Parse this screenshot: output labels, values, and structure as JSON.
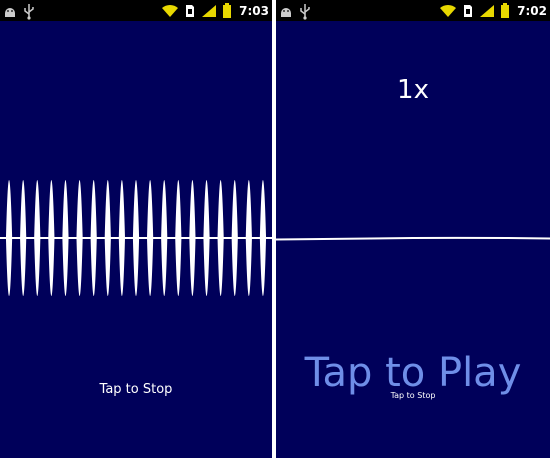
{
  "left_screen": {
    "status_bar": {
      "time": "7:03",
      "icons": [
        "android-debug-icon",
        "usb-icon",
        "wifi-icon",
        "sdcard-icon",
        "signal-icon",
        "battery-icon"
      ]
    },
    "waveform": {
      "state": "playing",
      "cycles": 19,
      "color": "#ffffff"
    },
    "action_label": "Tap to Stop"
  },
  "right_screen": {
    "status_bar": {
      "time": "7:02",
      "icons": [
        "android-debug-icon",
        "usb-icon",
        "wifi-icon",
        "sdcard-icon",
        "signal-icon",
        "battery-icon"
      ]
    },
    "speed_label": "1x",
    "waveform": {
      "state": "idle",
      "color": "#ffffff"
    },
    "play_label": "Tap to Play",
    "stop_label": "Tap to Stop"
  },
  "colors": {
    "background": "#00005a",
    "status_bar": "#000000",
    "play_text": "#6f8ee8",
    "divider": "#ffffff",
    "icon_yellow": "#e8d800"
  }
}
